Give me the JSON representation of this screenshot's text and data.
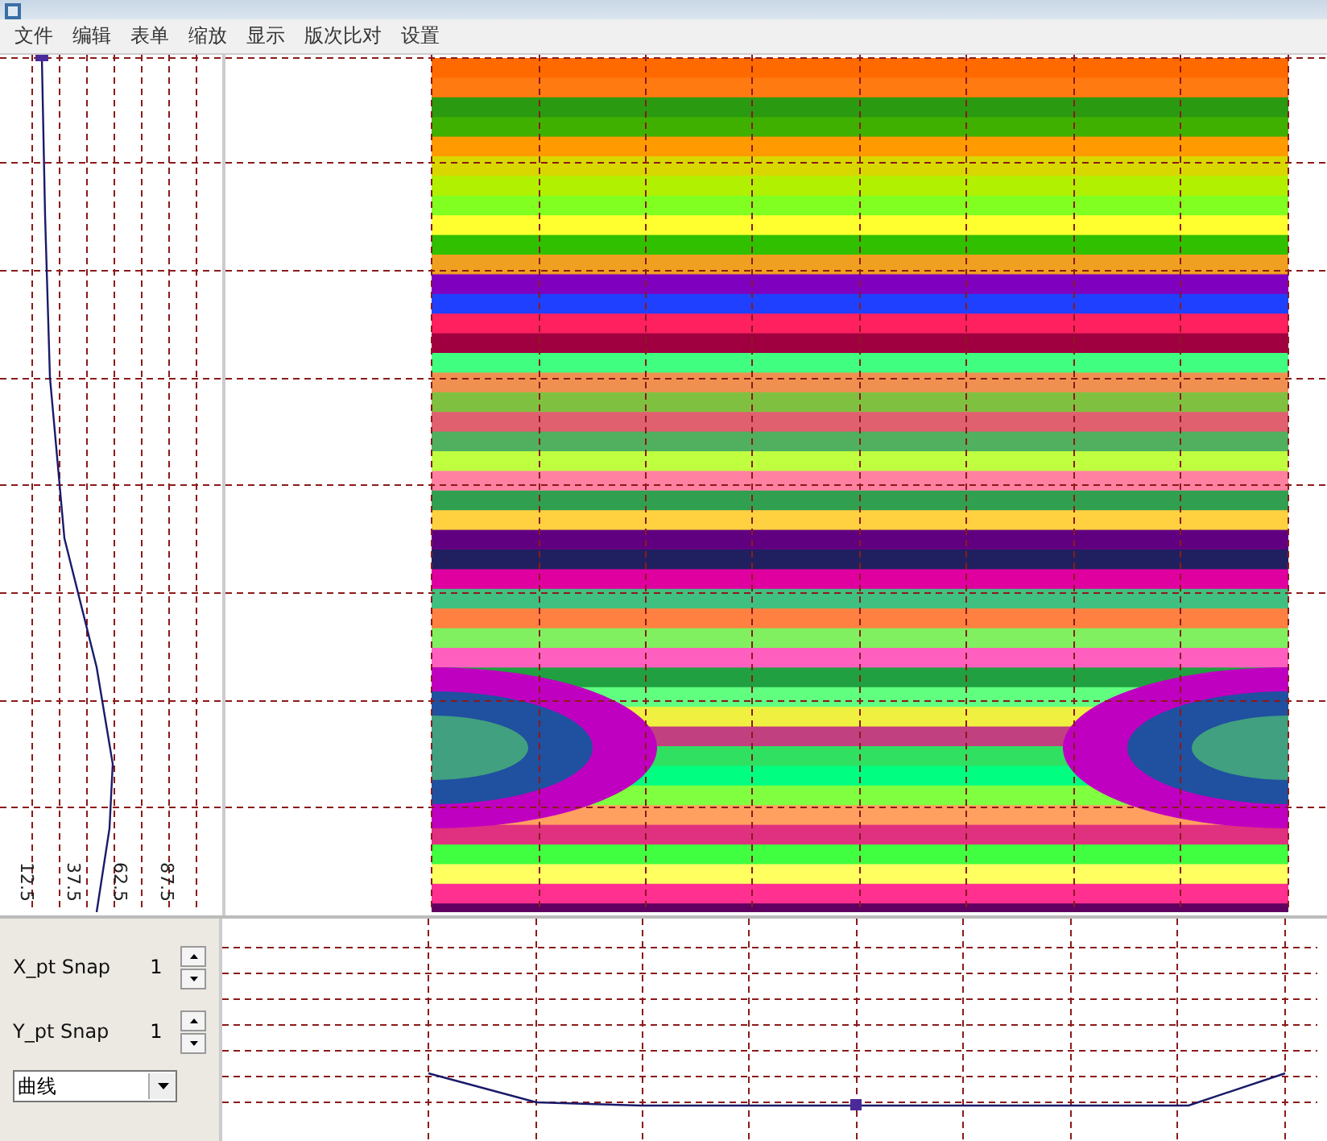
{
  "menu": [
    {
      "label": "文件"
    },
    {
      "label": "编辑"
    },
    {
      "label": "表单"
    },
    {
      "label": "缩放"
    },
    {
      "label": "显示"
    },
    {
      "label": "版次比对"
    },
    {
      "label": "设置"
    }
  ],
  "profile_panel": {
    "tick_labels": [
      "12.5",
      "37.5",
      "62.5",
      "87.5"
    ]
  },
  "controls": {
    "snaps": [
      {
        "label": "X_pt Snap",
        "value": "1"
      },
      {
        "label": "Y_pt Snap",
        "value": "1"
      }
    ],
    "curve_type": {
      "value": "曲线"
    }
  }
}
